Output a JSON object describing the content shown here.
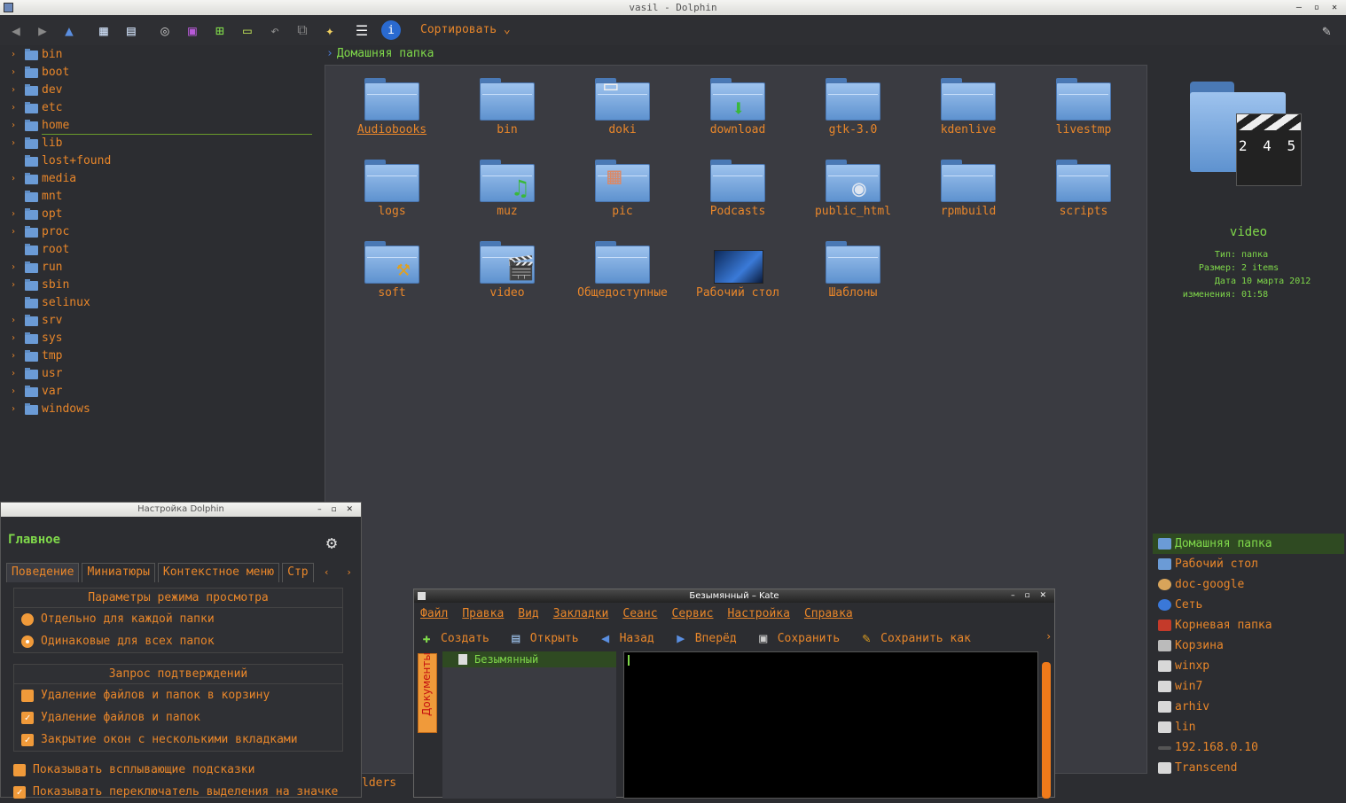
{
  "window": {
    "title": "vasil - Dolphin",
    "controls": "– ▫ ✕"
  },
  "toolbar": {
    "sort_label": "Сортировать ⌄",
    "icons": [
      "arrow-left-icon",
      "arrow-right-icon",
      "arrow-up-icon",
      "icons-view-icon",
      "details-view-icon",
      "binoculars-icon",
      "preview-icon",
      "new-tab-icon",
      "terminal-icon",
      "undo-icon",
      "copy-icon",
      "new-folder-icon",
      "menu-icon",
      "info-icon",
      "tools-icon"
    ]
  },
  "tree": {
    "items": [
      "bin",
      "boot",
      "dev",
      "etc",
      "home",
      "lib",
      "lost+found",
      "media",
      "mnt",
      "opt",
      "proc",
      "root",
      "run",
      "sbin",
      "selinux",
      "srv",
      "sys",
      "tmp",
      "usr",
      "var",
      "windows"
    ],
    "expandable": [
      true,
      true,
      true,
      true,
      true,
      true,
      false,
      true,
      false,
      true,
      true,
      false,
      true,
      true,
      false,
      true,
      true,
      true,
      true,
      true,
      true
    ]
  },
  "breadcrumb": {
    "path": "Домашняя папка"
  },
  "files": [
    {
      "name": "Audiobooks",
      "emblem": ""
    },
    {
      "name": "bin",
      "emblem": ""
    },
    {
      "name": "doki",
      "emblem": "papers"
    },
    {
      "name": "download",
      "emblem": "down-arrow"
    },
    {
      "name": "gtk-3.0",
      "emblem": ""
    },
    {
      "name": "kdenlive",
      "emblem": ""
    },
    {
      "name": "livestmp",
      "emblem": ""
    },
    {
      "name": "logs",
      "emblem": ""
    },
    {
      "name": "muz",
      "emblem": "music-note"
    },
    {
      "name": "pic",
      "emblem": "photos"
    },
    {
      "name": "Podcasts",
      "emblem": ""
    },
    {
      "name": "public_html",
      "emblem": "globe"
    },
    {
      "name": "rpmbuild",
      "emblem": ""
    },
    {
      "name": "scripts",
      "emblem": ""
    },
    {
      "name": "soft",
      "emblem": "hammer"
    },
    {
      "name": "video",
      "emblem": "clapboard"
    },
    {
      "name": "Общедоступные",
      "emblem": ""
    },
    {
      "name": "Рабочий стол",
      "emblem": "desktop"
    },
    {
      "name": "Шаблоны",
      "emblem": ""
    }
  ],
  "preview": {
    "name": "video",
    "clap_numbers": "2 4 5",
    "meta": [
      {
        "k": "Тип:",
        "v": "папка"
      },
      {
        "k": "Размер:",
        "v": "2 items"
      },
      {
        "k": "Дата изменения:",
        "v": "10 марта 2012 01:58"
      }
    ]
  },
  "places": [
    {
      "label": "Домашняя папка",
      "kind": "home",
      "active": true
    },
    {
      "label": "Рабочий стол",
      "kind": "desktop"
    },
    {
      "label": "doc-google",
      "kind": "user"
    },
    {
      "label": "Сеть",
      "kind": "globe"
    },
    {
      "label": "Корневая папка",
      "kind": "red"
    },
    {
      "label": "Корзина",
      "kind": "trash"
    },
    {
      "label": "winxp",
      "kind": "drv"
    },
    {
      "label": "win7",
      "kind": "drv"
    },
    {
      "label": "arhiv",
      "kind": "drv"
    },
    {
      "label": "lin",
      "kind": "drv"
    },
    {
      "label": "192.168.0.10",
      "kind": "flat"
    },
    {
      "label": "Transcend",
      "kind": "drv"
    }
  ],
  "settings": {
    "title": "Настройка Dolphin",
    "heading": "Главное",
    "tabs": [
      "Поведение",
      "Миниатюры",
      "Контекстное меню",
      "Стр"
    ],
    "tab_arrows": "‹ ›",
    "view_group": {
      "title": "Параметры режима просмотра",
      "options": [
        {
          "label": "Отдельно для каждой папки",
          "checked": false
        },
        {
          "label": "Одинаковые для всех папок",
          "checked": true
        }
      ]
    },
    "confirm_group": {
      "title": "Запрос подтверждений",
      "options": [
        {
          "label": "Удаление файлов и папок в корзину",
          "checked": false
        },
        {
          "label": "Удаление файлов и папок",
          "checked": true
        },
        {
          "label": "Закрытие окон с несколькими вкладками",
          "checked": true
        }
      ]
    },
    "loose_options": [
      {
        "label": "Показывать всплывающие подсказки",
        "checked": false
      },
      {
        "label": "Показывать переключатель выделения на значке",
        "checked": true
      }
    ]
  },
  "status_fragment": "lders",
  "kate": {
    "title": "Безымянный – Kate",
    "menu": [
      "Файл",
      "Правка",
      "Вид",
      "Закладки",
      "Сеанс",
      "Сервис",
      "Настройка",
      "Справка"
    ],
    "toolbar": [
      {
        "label": "Создать",
        "icon": "new-document-icon"
      },
      {
        "label": "Открыть",
        "icon": "open-folder-icon"
      },
      {
        "label": "Назад",
        "icon": "arrow-left-icon"
      },
      {
        "label": "Вперёд",
        "icon": "arrow-right-icon"
      },
      {
        "label": "Сохранить",
        "icon": "save-icon"
      },
      {
        "label": "Сохранить как",
        "icon": "save-as-icon"
      }
    ],
    "side_tab": "Документы",
    "file": "Безымянный",
    "more": "›"
  }
}
